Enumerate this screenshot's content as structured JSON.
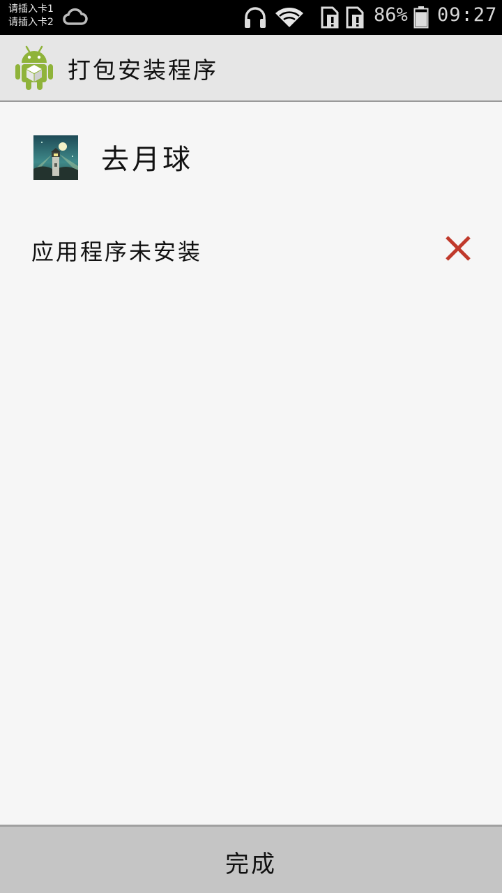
{
  "status_bar": {
    "sim1": "请插入卡1",
    "sim2": "请插入卡2",
    "battery_percent": "86%",
    "battery_level": 0.86,
    "time": "09:27",
    "icons": [
      "cloud-icon",
      "headset-icon",
      "wifi-icon",
      "sim-alert-icon",
      "sim-alert-icon",
      "battery-icon"
    ]
  },
  "app_bar": {
    "title": "打包安装程序",
    "logo_icon": "android-package-icon"
  },
  "app": {
    "name": "去月球",
    "icon": "to-the-moon-app-icon"
  },
  "install_result": {
    "message": "应用程序未安装",
    "status_icon": "close-icon",
    "status_color": "#c0392b"
  },
  "footer": {
    "done_label": "完成"
  }
}
